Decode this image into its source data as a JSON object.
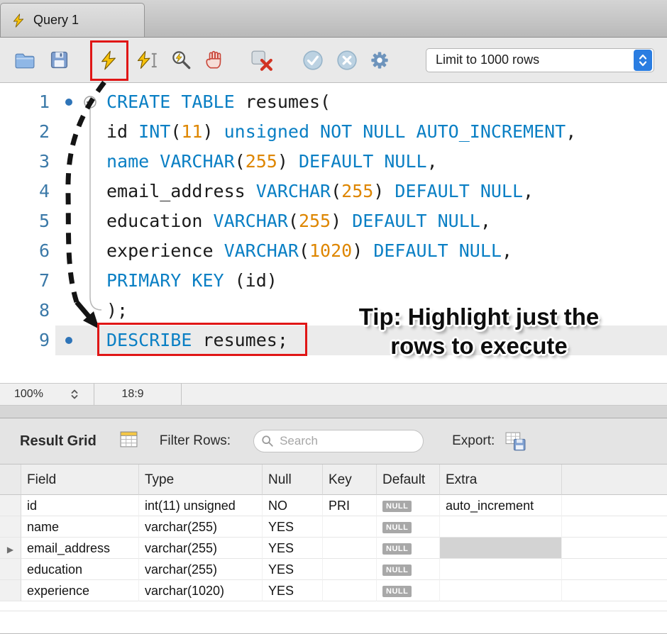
{
  "tab": {
    "title": "Query 1"
  },
  "toolbar": {
    "limit_value": "Limit to 1000 rows",
    "buttons": [
      "open-script",
      "save-script",
      "execute",
      "execute-current",
      "explain",
      "stop",
      "toggle-stop-on-error",
      "commit",
      "rollback",
      "autocommit"
    ]
  },
  "icons": {
    "tab": "lightning-bolt",
    "open_script": "folder",
    "save_script": "floppy-disk",
    "execute": "lightning-bolt",
    "execute_current": "lightning-bolt-with-cursor",
    "explain": "magnifier-with-bolt",
    "stop": "stop-hand",
    "toggle_stop_on_error": "toggle-with-red-x",
    "commit": "check-circle",
    "rollback": "x-circle",
    "autocommit": "gear",
    "dropdown_stepper": "up-down-chevrons",
    "result_grid": "spreadsheet",
    "search": "magnifier",
    "export": "grid-with-floppy",
    "row_pointer": "right-triangle"
  },
  "editor": {
    "lines": [
      {
        "num": "1",
        "seg": [
          {
            "c": "k",
            "t": "CREATE TABLE"
          },
          {
            "c": "p",
            "t": " resumes("
          }
        ]
      },
      {
        "num": "2",
        "seg": [
          {
            "c": "p",
            "t": "id "
          },
          {
            "c": "k",
            "t": "INT"
          },
          {
            "c": "p",
            "t": "("
          },
          {
            "c": "n",
            "t": "11"
          },
          {
            "c": "p",
            "t": ") "
          },
          {
            "c": "k",
            "t": "unsigned NOT NULL AUTO_INCREMENT"
          },
          {
            "c": "p",
            "t": ","
          }
        ]
      },
      {
        "num": "3",
        "seg": [
          {
            "c": "k",
            "t": "name"
          },
          {
            "c": "p",
            "t": " "
          },
          {
            "c": "k",
            "t": "VARCHAR"
          },
          {
            "c": "p",
            "t": "("
          },
          {
            "c": "n",
            "t": "255"
          },
          {
            "c": "p",
            "t": ") "
          },
          {
            "c": "k",
            "t": "DEFAULT NULL"
          },
          {
            "c": "p",
            "t": ","
          }
        ]
      },
      {
        "num": "4",
        "seg": [
          {
            "c": "p",
            "t": "email_address "
          },
          {
            "c": "k",
            "t": "VARCHAR"
          },
          {
            "c": "p",
            "t": "("
          },
          {
            "c": "n",
            "t": "255"
          },
          {
            "c": "p",
            "t": ") "
          },
          {
            "c": "k",
            "t": "DEFAULT NULL"
          },
          {
            "c": "p",
            "t": ","
          }
        ]
      },
      {
        "num": "5",
        "seg": [
          {
            "c": "p",
            "t": "education "
          },
          {
            "c": "k",
            "t": "VARCHAR"
          },
          {
            "c": "p",
            "t": "("
          },
          {
            "c": "n",
            "t": "255"
          },
          {
            "c": "p",
            "t": ") "
          },
          {
            "c": "k",
            "t": "DEFAULT NULL"
          },
          {
            "c": "p",
            "t": ","
          }
        ]
      },
      {
        "num": "6",
        "seg": [
          {
            "c": "p",
            "t": "experience "
          },
          {
            "c": "k",
            "t": "VARCHAR"
          },
          {
            "c": "p",
            "t": "("
          },
          {
            "c": "n",
            "t": "1020"
          },
          {
            "c": "p",
            "t": ") "
          },
          {
            "c": "k",
            "t": "DEFAULT NULL"
          },
          {
            "c": "p",
            "t": ","
          }
        ]
      },
      {
        "num": "7",
        "seg": [
          {
            "c": "k",
            "t": "PRIMARY KEY"
          },
          {
            "c": "p",
            "t": " (id)"
          }
        ]
      },
      {
        "num": "8",
        "seg": [
          {
            "c": "p",
            "t": ");"
          }
        ]
      },
      {
        "num": "9",
        "current": true,
        "seg": [
          {
            "c": "k",
            "t": "DESCRIBE"
          },
          {
            "c": "p",
            "t": " resumes;"
          }
        ]
      }
    ]
  },
  "annotation": {
    "line1": "Tip: Highlight just the",
    "line2": "rows to execute"
  },
  "status": {
    "zoom": "100%",
    "cursor": "18:9"
  },
  "results": {
    "title": "Result Grid",
    "filter_label": "Filter Rows:",
    "search_placeholder": "Search",
    "search_value": "",
    "export_label": "Export:",
    "columns": [
      "Field",
      "Type",
      "Null",
      "Key",
      "Default",
      "Extra"
    ],
    "rows": [
      {
        "field": "id",
        "type": "int(11) unsigned",
        "null": "NO",
        "key": "PRI",
        "default": "NULL",
        "extra": "auto_increment",
        "selected": false
      },
      {
        "field": "name",
        "type": "varchar(255)",
        "null": "YES",
        "key": "",
        "default": "NULL",
        "extra": "",
        "selected": false
      },
      {
        "field": "email_address",
        "type": "varchar(255)",
        "null": "YES",
        "key": "",
        "default": "NULL",
        "extra": "",
        "selected": true
      },
      {
        "field": "education",
        "type": "varchar(255)",
        "null": "YES",
        "key": "",
        "default": "NULL",
        "extra": "",
        "selected": false
      },
      {
        "field": "experience",
        "type": "varchar(1020)",
        "null": "YES",
        "key": "",
        "default": "NULL",
        "extra": "",
        "selected": false
      }
    ]
  },
  "colors": {
    "keyword": "#0a7fc4",
    "number": "#de8600",
    "highlight_red": "#e01616",
    "badge_gray": "#a8a8a8",
    "accent_blue": "#2a7de1"
  }
}
